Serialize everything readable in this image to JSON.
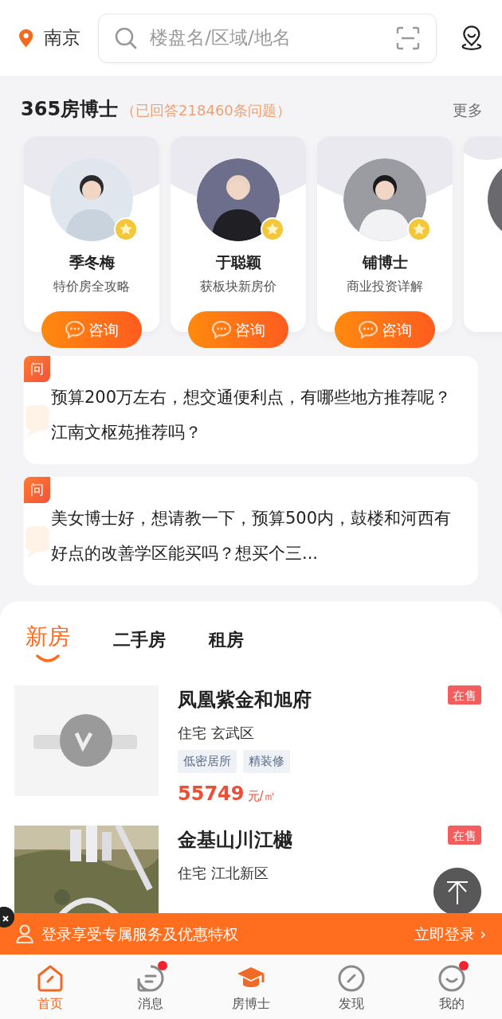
{
  "header": {
    "city": "南京",
    "search": {
      "placeholder": "楼盘名/区域/地名"
    }
  },
  "experts_section": {
    "title": "365房博士",
    "subtitle": "（已回答218460条问题）",
    "more": "更多",
    "experts": [
      {
        "name": "季冬梅",
        "specialty": "特价房全攻略",
        "button": "咨询"
      },
      {
        "name": "于聪颖",
        "specialty": "获板块新房价",
        "button": "咨询"
      },
      {
        "name": "铺博士",
        "specialty": "商业投资详解",
        "button": "咨询"
      },
      {
        "kind": "partial"
      }
    ],
    "questions": [
      {
        "badge": "问",
        "text": "预算200万左右，想交通便利点，有哪些地方推荐呢？江南文枢苑推荐吗？"
      },
      {
        "badge": "问",
        "text": "美女博士好，想请教一下，预算500内，鼓楼和河西有好点的改善学区能买吗？想买个三..."
      }
    ]
  },
  "listing_tabs": [
    {
      "label": "新房",
      "selected": true
    },
    {
      "label": "二手房",
      "selected": false
    },
    {
      "label": "租房",
      "selected": false
    }
  ],
  "listings": [
    {
      "title": "凤凰紫金和旭府",
      "status": "在售",
      "meta": "住宅 玄武区",
      "tags": [
        "低密居所",
        "精装修"
      ],
      "price": "55749",
      "unit": "元/㎡"
    },
    {
      "title": "金基山川江樾",
      "status": "在售",
      "meta": "住宅 江北新区"
    }
  ],
  "login_banner": {
    "text": "登录享受专属服务及优惠特权",
    "action": "立即登录 ›"
  },
  "bottom_nav": [
    {
      "label": "首页",
      "selected": true,
      "badge": false
    },
    {
      "label": "消息",
      "selected": false,
      "badge": true
    },
    {
      "label": "房博士",
      "selected": false,
      "badge": false
    },
    {
      "label": "发现",
      "selected": false,
      "badge": false
    },
    {
      "label": "我的",
      "selected": false,
      "badge": true
    }
  ]
}
